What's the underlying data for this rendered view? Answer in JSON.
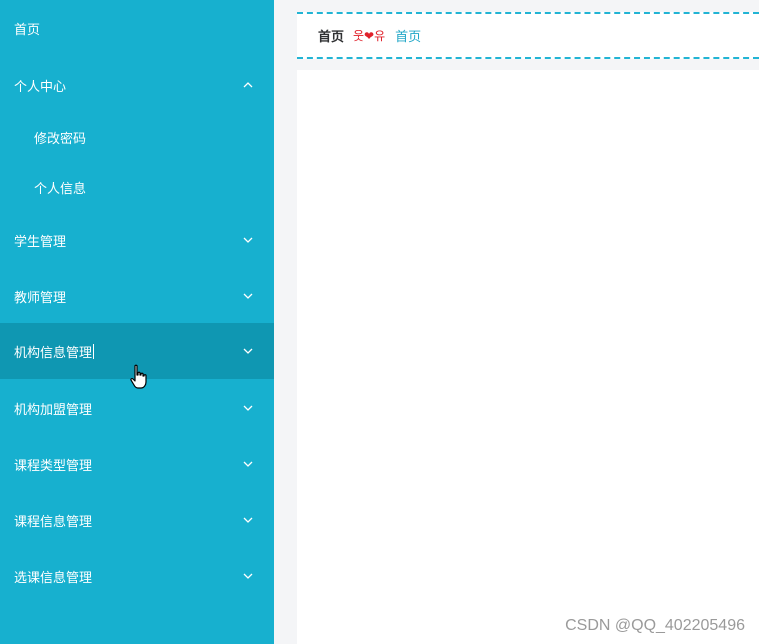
{
  "sidebar": {
    "items": [
      {
        "label": "首页"
      },
      {
        "label": "个人中心",
        "expanded": true
      },
      {
        "label": "修改密码"
      },
      {
        "label": "个人信息"
      },
      {
        "label": "学生管理"
      },
      {
        "label": "教师管理"
      },
      {
        "label": "机构信息管理",
        "active": true
      },
      {
        "label": "机构加盟管理"
      },
      {
        "label": "课程类型管理"
      },
      {
        "label": "课程信息管理"
      },
      {
        "label": "选课信息管理"
      }
    ]
  },
  "breadcrumb": {
    "home": "首页",
    "decoration": "웃❤유",
    "current": "首页"
  },
  "watermark": "CSDN @QQ_402205496",
  "colors": {
    "sidebar_bg": "#17b0cf",
    "sidebar_active_bg": "#0f97b2",
    "accent": "#22b4d4",
    "decoration_red": "#e0202a"
  },
  "icons": {
    "expand": "chevron-up-icon",
    "collapse": "chevron-down-icon",
    "cursor": "hand-pointer-icon"
  }
}
